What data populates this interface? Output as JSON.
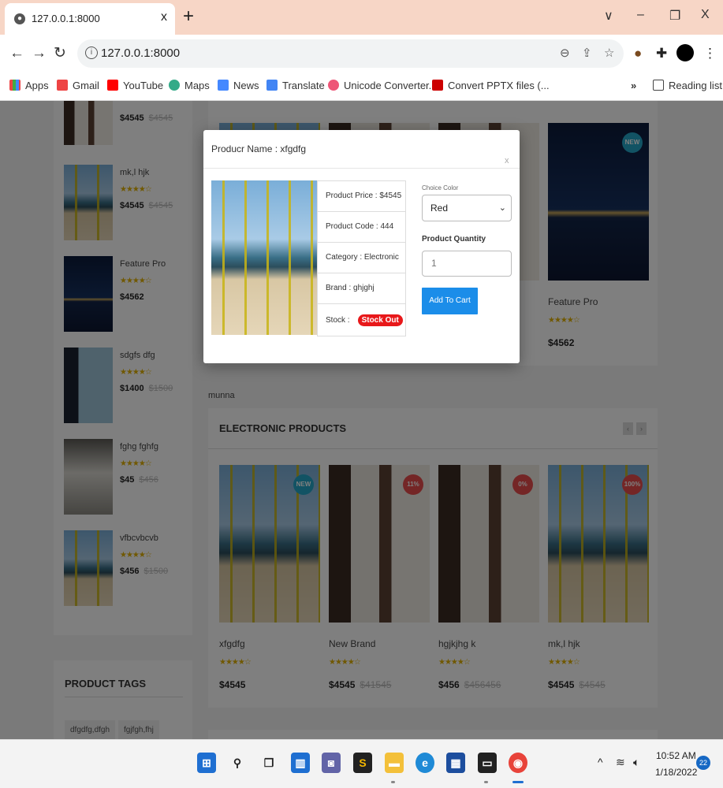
{
  "browser": {
    "tab_title": "127.0.0.1:8000",
    "tab_close": "x",
    "new_tab": "+",
    "url": "127.0.0.1:8000",
    "window_controls": {
      "chevron": "∨",
      "minimize": "–",
      "maximize": "❐",
      "close": "X"
    },
    "bookmarks": [
      "Apps",
      "Gmail",
      "YouTube",
      "Maps",
      "News",
      "Translate",
      "Unicode Converter...",
      "Convert PPTX files (...",
      "Reading list"
    ],
    "bookmarks_more": "»"
  },
  "sidebar_products": [
    {
      "name": "",
      "price": "$4545",
      "old_price": "$4545",
      "image": "room"
    },
    {
      "name": "mk,l hjk",
      "stars": "★★★★☆",
      "price": "$4545",
      "old_price": "$4545",
      "image": "beach"
    },
    {
      "name": "Feature Pro",
      "stars": "★★★★☆",
      "price": "$4562",
      "old_price": "",
      "image": "night"
    },
    {
      "name": "sdgfs dfg",
      "stars": "★★★★☆",
      "price": "$1400",
      "old_price": "$1500",
      "image": "balcony"
    },
    {
      "name": "fghg fghfg",
      "stars": "★★★★☆",
      "price": "$45",
      "old_price": "$456",
      "image": "crowd"
    },
    {
      "name": "vfbcvbcvb",
      "stars": "★★★★☆",
      "price": "$456",
      "old_price": "$1500",
      "image": "beach"
    }
  ],
  "product_tags": {
    "title": "PRODUCT TAGS",
    "tags": [
      "dfgdfg,dfgh",
      "fgjfgh,fhj"
    ]
  },
  "top_products": {
    "visible_badge": "NEW",
    "feature": {
      "name": "Feature Pro",
      "stars": "★★★★☆",
      "price": "$4562"
    }
  },
  "section_label": "munna",
  "electronic": {
    "title": "ELECTRONIC PRODUCTS",
    "prev": "‹",
    "next": "›",
    "products": [
      {
        "name": "xfgdfg",
        "stars": "★★★★☆",
        "price": "$4545",
        "old_price": "",
        "badge": "NEW",
        "image": "beach"
      },
      {
        "name": "New Brand",
        "stars": "★★★★☆",
        "price": "$4545",
        "old_price": "$41545",
        "badge": "11%",
        "image": "room"
      },
      {
        "name": "hgjkjhg k",
        "stars": "★★★★☆",
        "price": "$456",
        "old_price": "$456456",
        "badge": "0%",
        "image": "room"
      },
      {
        "name": "mk,l hjk",
        "stars": "★★★★☆",
        "price": "$4545",
        "old_price": "$4545",
        "badge": "100%",
        "image": "beach"
      }
    ]
  },
  "modal": {
    "title": "Producr Name : xfgdfg",
    "close": "x",
    "price": "Product Price : $4545",
    "code": "Product Code : 444",
    "category": "Category : Electronic",
    "brand": "Brand : ghjghj",
    "stock_label": "Stock :",
    "stock_status": "Stock Out",
    "color_label": "Choice Color",
    "color_value": "Red",
    "qty_label": "Product Quantity",
    "qty_value": "1",
    "add_to_cart": "Add To Cart"
  },
  "taskbar": {
    "time": "10:52 AM",
    "date": "1/18/2022",
    "notifications": "22"
  },
  "colors": {
    "accent": "#1b8de9",
    "stock_out": "#e8181a",
    "badge_new": "#25a7c9",
    "badge_discount": "#e84c4c",
    "star": "#e0b000"
  }
}
